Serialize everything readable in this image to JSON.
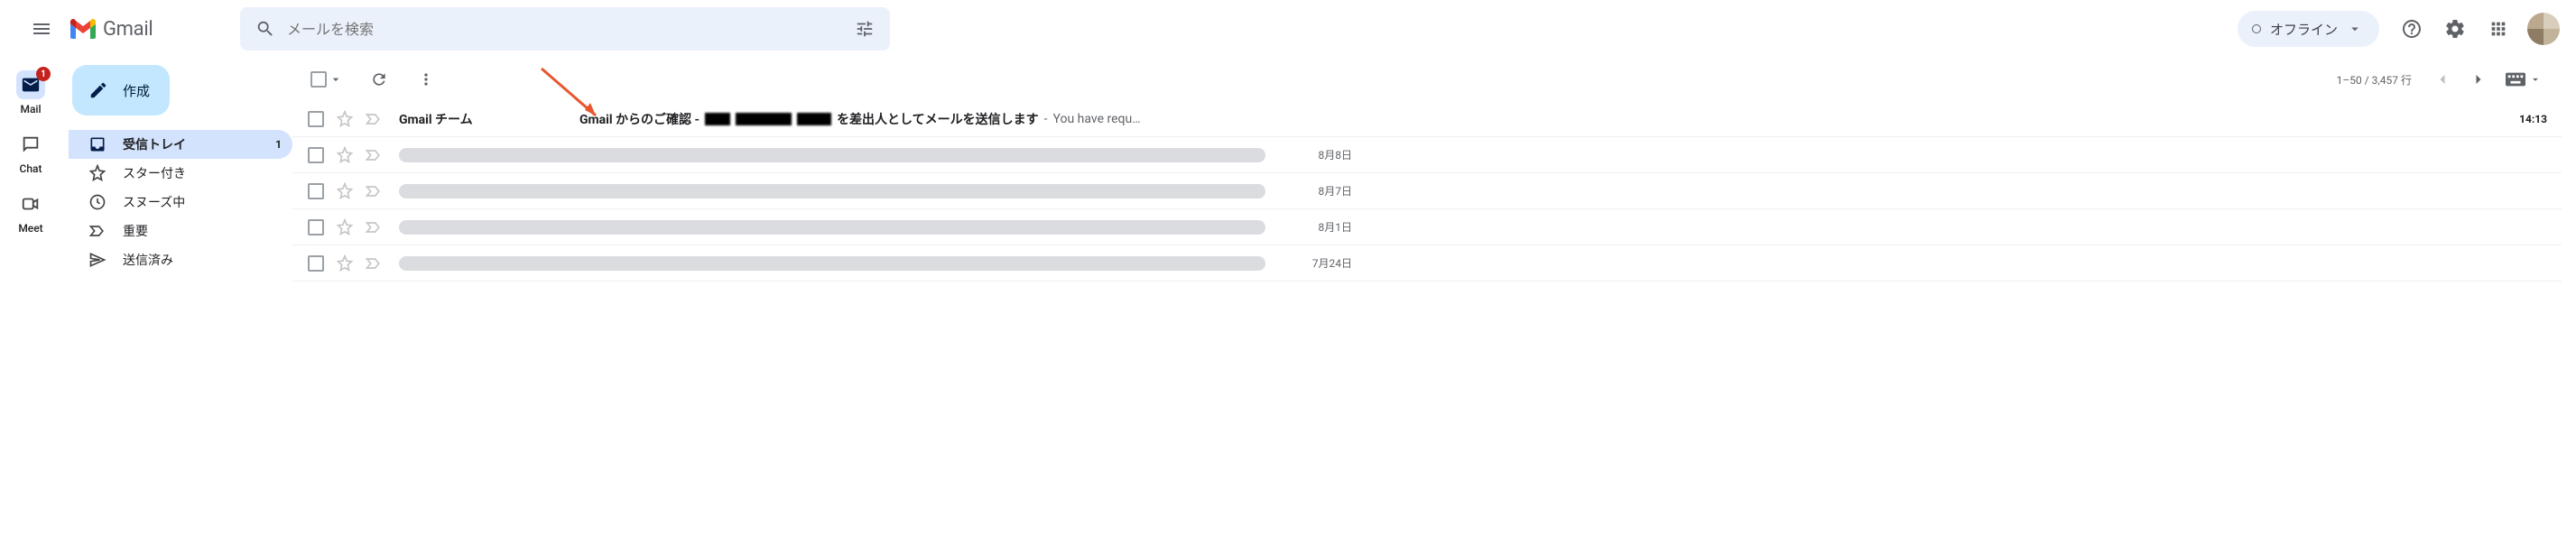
{
  "header": {
    "product_name": "Gmail",
    "search_placeholder": "メールを検索",
    "offline_label": "オフライン"
  },
  "rail": {
    "items": [
      {
        "label": "Mail",
        "badge": "1",
        "active": true
      },
      {
        "label": "Chat",
        "badge": null,
        "active": false
      },
      {
        "label": "Meet",
        "badge": null,
        "active": false
      }
    ]
  },
  "sidebar": {
    "compose_label": "作成",
    "items": [
      {
        "icon": "inbox",
        "label": "受信トレイ",
        "count": "1",
        "active": true
      },
      {
        "icon": "star",
        "label": "スター付き",
        "count": null,
        "active": false
      },
      {
        "icon": "clock",
        "label": "スヌーズ中",
        "count": null,
        "active": false
      },
      {
        "icon": "important",
        "label": "重要",
        "count": null,
        "active": false
      },
      {
        "icon": "send",
        "label": "送信済み",
        "count": null,
        "active": false
      }
    ]
  },
  "toolbar": {
    "page_info": "1–50 / 3,457 行"
  },
  "rows": [
    {
      "unread": true,
      "sender": "Gmail チーム",
      "subject_prefix": "Gmail からのご確認 -",
      "subject_redacted": true,
      "subject_suffix": "を差出人としてメールを送信します",
      "preview": "You have requ…",
      "date": "14:13"
    },
    {
      "unread": false,
      "sender": "",
      "redacted_row": true,
      "date": "8月8日"
    },
    {
      "unread": false,
      "sender": "",
      "redacted_row": true,
      "date": "8月7日"
    },
    {
      "unread": false,
      "sender": "",
      "redacted_row": true,
      "date": "8月1日"
    },
    {
      "unread": false,
      "sender": "",
      "redacted_row": true,
      "date": "7月24日"
    }
  ]
}
